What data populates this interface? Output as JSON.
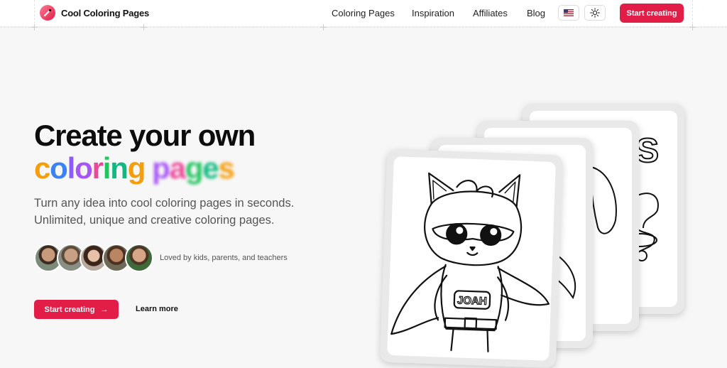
{
  "header": {
    "brand": "Cool Coloring Pages",
    "nav": [
      {
        "label": "Coloring Pages"
      },
      {
        "label": "Inspiration"
      },
      {
        "label": "Affiliates"
      },
      {
        "label": "Blog"
      }
    ],
    "cta_label": "Start creating"
  },
  "hero": {
    "title_line1": "Create your own",
    "title_word1": "coloring",
    "title_word2": "pages",
    "subtitle_line1": "Turn any idea into cool coloring pages in seconds.",
    "subtitle_line2": "Unlimited, unique and creative coloring pages.",
    "social_proof": "Loved by kids, parents, and teachers",
    "primary_cta": "Start creating",
    "secondary_cta": "Learn more"
  },
  "cards": {
    "front_name": "JOAH",
    "back_letters": "ES"
  },
  "colors": {
    "brand": "#e11d48",
    "gradient_word": [
      "#f59e0b",
      "#3b82f6",
      "#8b5cf6",
      "#a855f7",
      "#ec4899",
      "#22c55e",
      "#10b981"
    ]
  }
}
